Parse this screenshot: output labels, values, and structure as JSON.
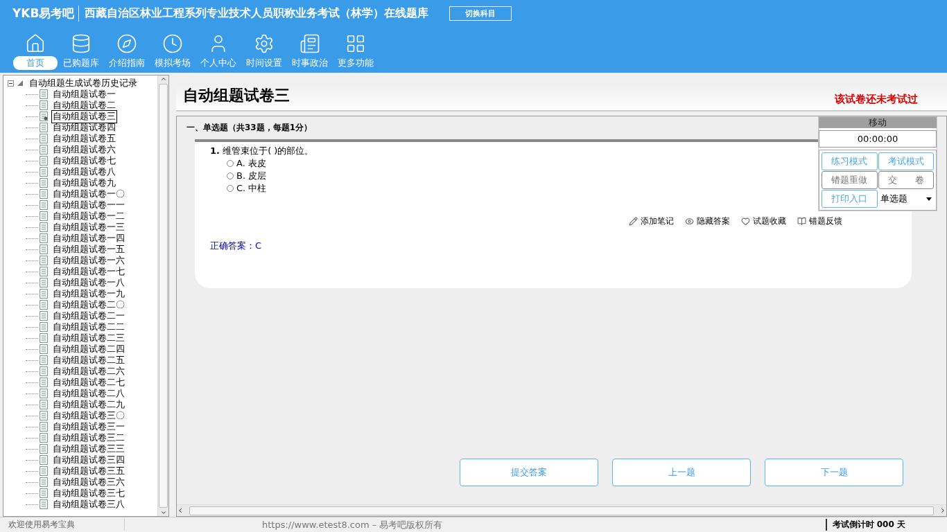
{
  "header": {
    "logo": "YKB易考吧",
    "title": "西藏自治区林业工程系列专业技术人员职称业务考试（林学）在线题库",
    "switch_button": "切换科目"
  },
  "nav": [
    {
      "label": "首页",
      "selected": true
    },
    {
      "label": "已购题库",
      "selected": false
    },
    {
      "label": "介绍指南",
      "selected": false
    },
    {
      "label": "模拟考场",
      "selected": false
    },
    {
      "label": "个人中心",
      "selected": false
    },
    {
      "label": "时间设置",
      "selected": false
    },
    {
      "label": "时事政治",
      "selected": false
    },
    {
      "label": "更多功能",
      "selected": false
    }
  ],
  "tree": {
    "root": "自动组题生成试卷历史记录",
    "expanded": true,
    "children": [
      {
        "label": "自动组题试卷一",
        "selected": false
      },
      {
        "label": "自动组题试卷二",
        "selected": false
      },
      {
        "label": "自动组题试卷三",
        "selected": true
      },
      {
        "label": "自动组题试卷四",
        "selected": false
      },
      {
        "label": "自动组题试卷五",
        "selected": false
      },
      {
        "label": "自动组题试卷六",
        "selected": false
      },
      {
        "label": "自动组题试卷七",
        "selected": false
      },
      {
        "label": "自动组题试卷八",
        "selected": false
      },
      {
        "label": "自动组题试卷九",
        "selected": false
      },
      {
        "label": "自动组题试卷一〇",
        "selected": false
      },
      {
        "label": "自动组题试卷一一",
        "selected": false
      },
      {
        "label": "自动组题试卷一二",
        "selected": false
      },
      {
        "label": "自动组题试卷一三",
        "selected": false
      },
      {
        "label": "自动组题试卷一四",
        "selected": false
      },
      {
        "label": "自动组题试卷一五",
        "selected": false
      },
      {
        "label": "自动组题试卷一六",
        "selected": false
      },
      {
        "label": "自动组题试卷一七",
        "selected": false
      },
      {
        "label": "自动组题试卷一八",
        "selected": false
      },
      {
        "label": "自动组题试卷一九",
        "selected": false
      },
      {
        "label": "自动组题试卷二〇",
        "selected": false
      },
      {
        "label": "自动组题试卷二一",
        "selected": false
      },
      {
        "label": "自动组题试卷二二",
        "selected": false
      },
      {
        "label": "自动组题试卷二三",
        "selected": false
      },
      {
        "label": "自动组题试卷二四",
        "selected": false
      },
      {
        "label": "自动组题试卷二五",
        "selected": false
      },
      {
        "label": "自动组题试卷二六",
        "selected": false
      },
      {
        "label": "自动组题试卷二七",
        "selected": false
      },
      {
        "label": "自动组题试卷二八",
        "selected": false
      },
      {
        "label": "自动组题试卷二九",
        "selected": false
      },
      {
        "label": "自动组题试卷三〇",
        "selected": false
      },
      {
        "label": "自动组题试卷三一",
        "selected": false
      },
      {
        "label": "自动组题试卷三二",
        "selected": false
      },
      {
        "label": "自动组题试卷三三",
        "selected": false
      },
      {
        "label": "自动组题试卷三四",
        "selected": false
      },
      {
        "label": "自动组题试卷三五",
        "selected": false
      },
      {
        "label": "自动组题试卷三六",
        "selected": false
      },
      {
        "label": "自动组题试卷三七",
        "selected": false
      },
      {
        "label": "自动组题试卷三八",
        "selected": false
      }
    ]
  },
  "paper": {
    "title": "自动组题试卷三",
    "status": "该试卷还未考试过",
    "section": "一、单选题（共33题，每题1分）",
    "question": {
      "number": "1.",
      "text": "维管束位于( )的部位。",
      "options": [
        {
          "label": "A. 表皮",
          "selected": false
        },
        {
          "label": "B. 皮层",
          "selected": false
        },
        {
          "label": "C. 中柱",
          "selected": false
        }
      ],
      "actions": [
        "添加笔记",
        "隐藏答案",
        "试题收藏",
        "错题反馈"
      ],
      "answer": "正确答案：C"
    },
    "buttons": [
      "提交答案",
      "上一题",
      "下一题"
    ]
  },
  "panel": {
    "title": "移动",
    "timer": "00:00:00",
    "buttons": [
      {
        "label": "练习模式",
        "disabled": false
      },
      {
        "label": "考试模式",
        "disabled": false
      },
      {
        "label": "错题重做",
        "disabled": true
      },
      {
        "label": "交　　卷",
        "disabled": true
      },
      {
        "label": "打印入口",
        "disabled": false
      }
    ],
    "select": "单选题"
  },
  "status_bar": {
    "welcome": "欢迎使用易考宝典",
    "copyright": "https://www.etest8.com – 易考吧版权所有",
    "countdown": "考试倒计时 000 天"
  }
}
